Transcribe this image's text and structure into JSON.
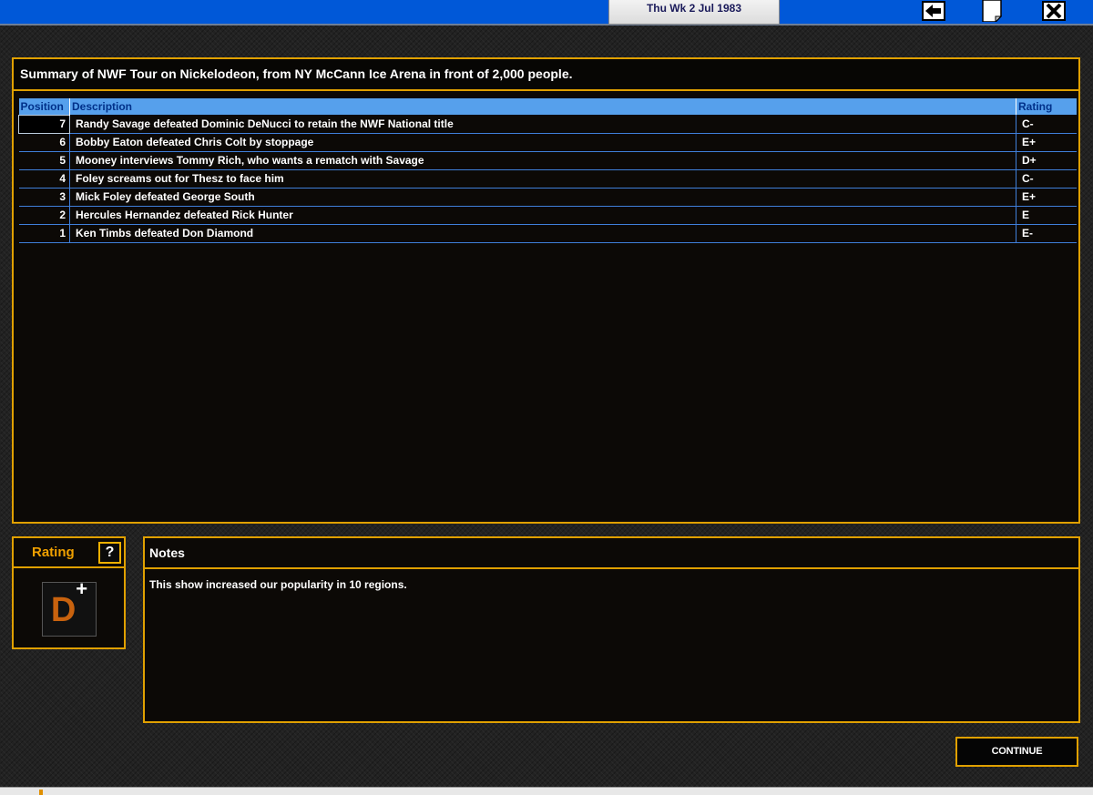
{
  "topbar": {
    "date": "Thu Wk 2 Jul 1983",
    "icons": [
      "back-arrow-icon",
      "notepad-icon",
      "close-icon"
    ]
  },
  "summary": {
    "title": "Summary of NWF Tour on Nickelodeon, from NY McCann Ice Arena in front of 2,000 people.",
    "columns": {
      "position": "Position",
      "description": "Description",
      "rating": "Rating"
    },
    "rows": [
      {
        "position": "7",
        "description": "Randy Savage defeated Dominic DeNucci to retain the NWF National title",
        "rating": "C-"
      },
      {
        "position": "6",
        "description": "Bobby Eaton defeated Chris Colt by stoppage",
        "rating": "E+"
      },
      {
        "position": "5",
        "description": "Mooney interviews Tommy Rich, who wants a rematch with Savage",
        "rating": "D+"
      },
      {
        "position": "4",
        "description": "Foley screams out for Thesz to face him",
        "rating": "C-"
      },
      {
        "position": "3",
        "description": "Mick Foley defeated George South",
        "rating": "E+"
      },
      {
        "position": "2",
        "description": "Hercules Hernandez defeated Rick Hunter",
        "rating": "E"
      },
      {
        "position": "1",
        "description": "Ken Timbs defeated Don Diamond",
        "rating": "E-"
      }
    ]
  },
  "rating": {
    "label": "Rating",
    "help": "?",
    "grade_letter": "D",
    "grade_modifier": "+"
  },
  "notes": {
    "header": "Notes",
    "text": "This show increased our popularity in 10 regions."
  },
  "actions": {
    "continue_label": "CONTINUE"
  },
  "colors": {
    "accent_border": "#e0a000",
    "topbar_blue": "#0058d8",
    "table_header": "#56a0ec",
    "grade": "#c8620e"
  }
}
